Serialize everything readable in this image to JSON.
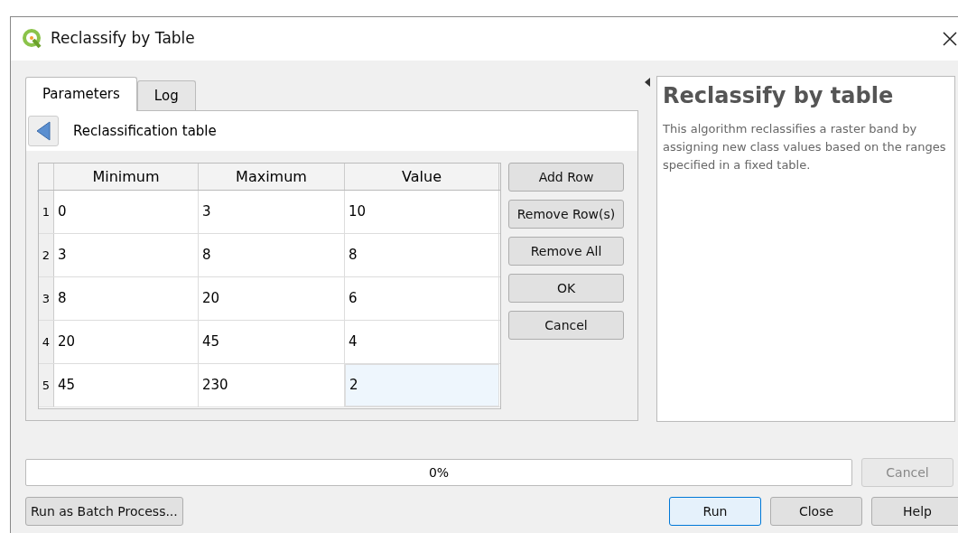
{
  "window": {
    "title": "Reclassify by Table"
  },
  "tabs": [
    {
      "label": "Parameters",
      "selected": true
    },
    {
      "label": "Log",
      "selected": false
    }
  ],
  "parameter": {
    "label": "Reclassification table"
  },
  "table": {
    "columns": [
      "Minimum",
      "Maximum",
      "Value"
    ],
    "rows": [
      {
        "number": "1",
        "cells": [
          {
            "text": "0",
            "selected": false
          },
          {
            "text": "3",
            "selected": false
          },
          {
            "text": "10",
            "selected": false
          }
        ]
      },
      {
        "number": "2",
        "cells": [
          {
            "text": "3",
            "selected": false
          },
          {
            "text": "8",
            "selected": false
          },
          {
            "text": "8",
            "selected": false
          }
        ]
      },
      {
        "number": "3",
        "cells": [
          {
            "text": "8",
            "selected": false
          },
          {
            "text": "20",
            "selected": false
          },
          {
            "text": "6",
            "selected": false
          }
        ]
      },
      {
        "number": "4",
        "cells": [
          {
            "text": "20",
            "selected": false
          },
          {
            "text": "45",
            "selected": false
          },
          {
            "text": "4",
            "selected": false
          }
        ]
      },
      {
        "number": "5",
        "cells": [
          {
            "text": "45",
            "selected": false
          },
          {
            "text": "230",
            "selected": false
          },
          {
            "text": "2",
            "selected": true
          }
        ]
      }
    ]
  },
  "table_buttons": [
    "Add Row",
    "Remove Row(s)",
    "Remove All",
    "OK",
    "Cancel"
  ],
  "help": {
    "title": "Reclassify by table",
    "text": "This algorithm reclassifies a raster band by assigning new class values based on the ranges specified in a fixed table."
  },
  "progress": {
    "level": 0,
    "reading": "0%"
  },
  "cancel_button": {
    "label": "Cancel",
    "disabled": true
  },
  "batch_button": "Run as Batch Process...",
  "buttons": [
    {
      "label": "Run",
      "focused": true
    },
    {
      "label": "Close",
      "focused": false
    },
    {
      "label": "Help",
      "focused": false
    }
  ]
}
